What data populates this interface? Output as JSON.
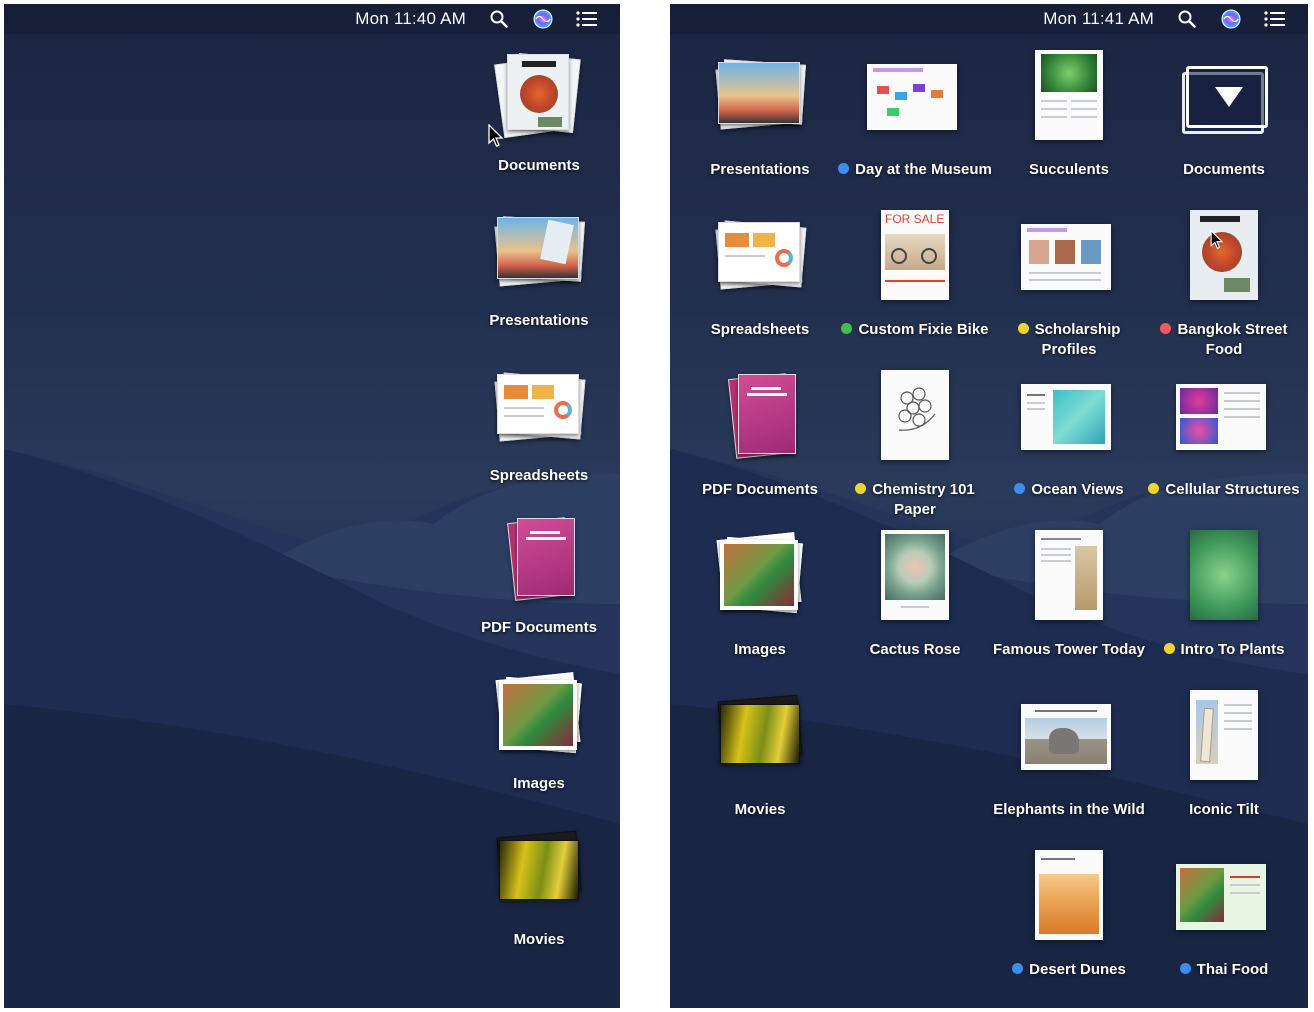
{
  "left": {
    "menubar": {
      "time": "Mon 11:40 AM"
    },
    "stacks": [
      {
        "label": "Documents"
      },
      {
        "label": "Presentations"
      },
      {
        "label": "Spreadsheets"
      },
      {
        "label": "PDF Documents"
      },
      {
        "label": "Images"
      },
      {
        "label": "Movies"
      }
    ]
  },
  "right": {
    "menubar": {
      "time": "Mon 11:41 AM"
    },
    "items": [
      {
        "label": "Presentations",
        "tag": ""
      },
      {
        "label": "Day at the Museum",
        "tag": "#3b8df0"
      },
      {
        "label": "Succulents",
        "tag": ""
      },
      {
        "label": "Documents",
        "tag": ""
      },
      {
        "label": "Spreadsheets",
        "tag": ""
      },
      {
        "label": "Custom Fixie Bike",
        "tag": "#3ec24a",
        "thumb_title": "FOR SALE"
      },
      {
        "label": "Scholarship Profiles",
        "tag": "#f2d230"
      },
      {
        "label": "Bangkok Street Food",
        "tag": "#f05a5a"
      },
      {
        "label": "PDF Documents",
        "tag": ""
      },
      {
        "label": "Chemistry 101 Paper",
        "tag": "#f2d230"
      },
      {
        "label": "Ocean Views",
        "tag": "#3b8df0"
      },
      {
        "label": "Cellular Structures",
        "tag": "#f2d230"
      },
      {
        "label": "Images",
        "tag": ""
      },
      {
        "label": "Cactus Rose",
        "tag": ""
      },
      {
        "label": "Famous Tower Today",
        "tag": ""
      },
      {
        "label": "Intro To Plants",
        "tag": "#f2d230"
      },
      {
        "label": "Movies",
        "tag": ""
      },
      {
        "label": "Elephants in the Wild",
        "tag": ""
      },
      {
        "label": "Iconic Tilt",
        "tag": ""
      },
      {
        "label": "Desert Dunes",
        "tag": "#3b8df0"
      },
      {
        "label": "Thai Food",
        "tag": "#3b8df0"
      }
    ]
  },
  "icons": [
    "search-icon",
    "siri-icon",
    "notification-center-icon",
    "collapse-stack-icon",
    "mouse-pointer-icon"
  ]
}
